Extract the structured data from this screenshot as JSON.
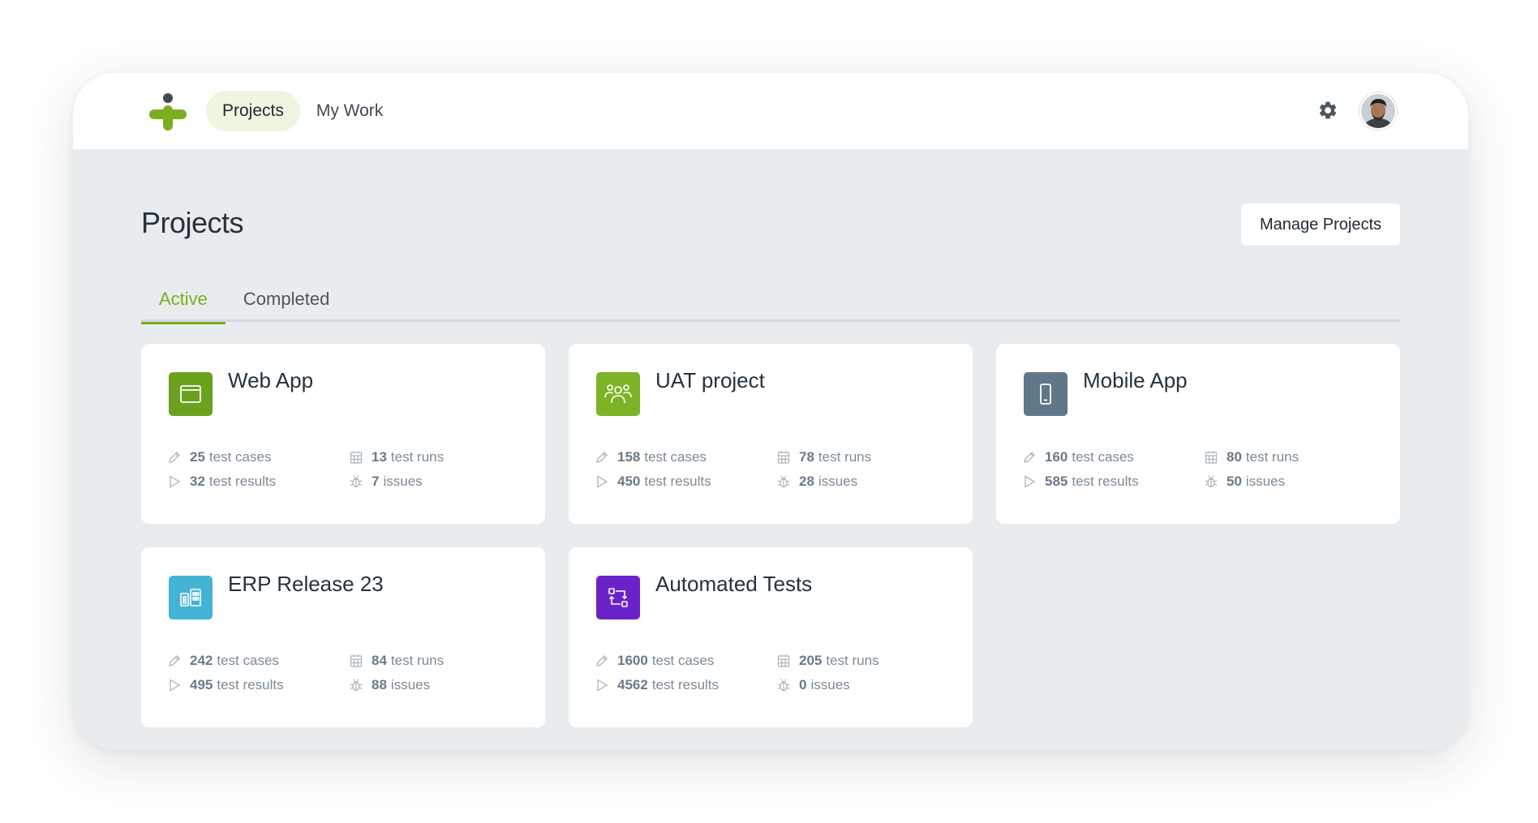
{
  "nav": {
    "items": [
      {
        "label": "Projects",
        "active": true
      },
      {
        "label": "My Work",
        "active": false
      }
    ]
  },
  "header": {
    "settings_icon": "gear-icon",
    "avatar_icon": "user-avatar"
  },
  "page": {
    "title": "Projects",
    "manage_button": "Manage Projects"
  },
  "tabs": [
    {
      "label": "Active",
      "active": true
    },
    {
      "label": "Completed",
      "active": false
    }
  ],
  "stat_labels": {
    "cases": "test cases",
    "results": "test results",
    "runs": "test runs",
    "issues": "issues"
  },
  "projects": [
    {
      "name": "Web App",
      "icon": "browser-window-icon",
      "color": "#6aa11e",
      "test_cases": "25",
      "test_results": "32",
      "test_runs": "13",
      "issues": "7"
    },
    {
      "name": "UAT project",
      "icon": "users-group-icon",
      "color": "#7cb327",
      "test_cases": "158",
      "test_results": "450",
      "test_runs": "78",
      "issues": "28"
    },
    {
      "name": "Mobile App",
      "icon": "mobile-phone-icon",
      "color": "#5f7787",
      "test_cases": "160",
      "test_results": "585",
      "test_runs": "80",
      "issues": "50"
    },
    {
      "name": "ERP Release 23",
      "icon": "building-modules-icon",
      "color": "#45b3d6",
      "test_cases": "242",
      "test_results": "495",
      "test_runs": "84",
      "issues": "88"
    },
    {
      "name": "Automated Tests",
      "icon": "automation-cycle-icon",
      "color": "#6c22c9",
      "test_cases": "1600",
      "test_results": "4562",
      "test_runs": "205",
      "issues": "0"
    }
  ],
  "colors": {
    "accent": "#7cac1f",
    "background": "#e9ecef",
    "card": "#ffffff"
  }
}
